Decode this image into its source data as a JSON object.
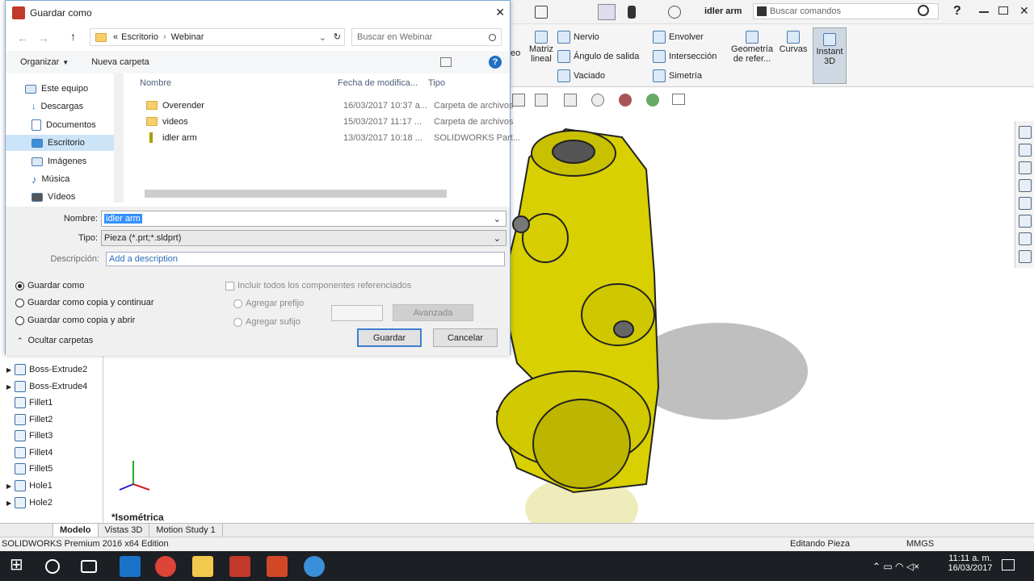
{
  "app": {
    "document_name": "idler arm",
    "search_commands_placeholder": "Buscar comandos",
    "version_text": "SOLIDWORKS Premium 2016 x64 Edition",
    "status_editing": "Editando Pieza",
    "status_units": "MMGS",
    "view_label": "*Isométrica",
    "colors": {
      "part_yellow": "#d8d000",
      "accent_blue": "#3c7fd0"
    }
  },
  "ribbon": {
    "partial_label": "eo",
    "matrix_label": "Matriz lineal",
    "rib_label": "Nervio",
    "draft_label": "Ángulo de salida",
    "shell_label": "Vaciado",
    "wrap_label": "Envolver",
    "intersect_label": "Intersección",
    "mirror_label": "Simetría",
    "refgeom_label": "Geometría de refer...",
    "curves_label": "Curvas",
    "instant3d_label": "Instant 3D"
  },
  "tree": {
    "items": [
      {
        "label": "Boss-Extrude2"
      },
      {
        "label": "Boss-Extrude4"
      },
      {
        "label": "Fillet1"
      },
      {
        "label": "Fillet2"
      },
      {
        "label": "Fillet3"
      },
      {
        "label": "Fillet4"
      },
      {
        "label": "Fillet5"
      },
      {
        "label": "Hole1"
      },
      {
        "label": "Hole2"
      }
    ]
  },
  "tabs": [
    "Modelo",
    "Vistas 3D",
    "Motion Study 1"
  ],
  "dialog": {
    "title": "Guardar como",
    "breadcrumb": [
      "«",
      "Escritorio",
      "Webinar"
    ],
    "search_placeholder": "Buscar en Webinar",
    "organize_label": "Organizar",
    "new_folder_label": "Nueva carpeta",
    "nav_items": [
      "Este equipo",
      "Descargas",
      "Documentos",
      "Escritorio",
      "Imágenes",
      "Música",
      "Vídeos"
    ],
    "columns": [
      "Nombre",
      "Fecha de modifica...",
      "Tipo"
    ],
    "files": [
      {
        "name": "Overender",
        "date": "16/03/2017 10:37 a...",
        "type": "Carpeta de archivos"
      },
      {
        "name": "videos",
        "date": "15/03/2017 11:17 ...",
        "type": "Carpeta de archivos"
      },
      {
        "name": "idler arm",
        "date": "13/03/2017 10:18 ...",
        "type": "SOLIDWORKS Part..."
      }
    ],
    "filename_label": "Nombre:",
    "filename_value": "idler arm",
    "type_label": "Tipo:",
    "type_value": "Pieza (*.prt;*.sldprt)",
    "description_label": "Descripción:",
    "description_placeholder": "Add a description",
    "options": [
      "Guardar como",
      "Guardar como copia y continuar",
      "Guardar como copia y abrir"
    ],
    "include_refs_label": "Incluir todos los componentes referenciados",
    "add_prefix_label": "Agregar prefijo",
    "add_suffix_label": "Agregar sufijo",
    "advanced_label": "Avanzada",
    "hide_folders_label": "Ocultar carpetas",
    "save_label": "Guardar",
    "cancel_label": "Cancelar"
  },
  "taskbar": {
    "time": "11:11 a. m.",
    "date": "16/03/2017"
  }
}
